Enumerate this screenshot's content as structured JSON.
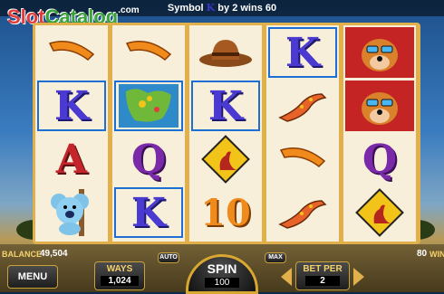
{
  "header": {
    "win_prefix": "Symbol",
    "win_symbol": "K",
    "win_suffix": "by 2 wins 60"
  },
  "logo": {
    "part1": "Slot",
    "part2": "Catalog",
    "tld": ".com"
  },
  "reels": [
    [
      "boomerang",
      "K",
      "A",
      "koala"
    ],
    [
      "boomerang",
      "bonus-map",
      "Q",
      "K"
    ],
    [
      "hat",
      "K",
      "kangaroo-sign",
      "10"
    ],
    [
      "K",
      "lizard",
      "boomerang",
      "lizard"
    ],
    [
      "dingo",
      "dingo",
      "Q",
      "kangaroo-sign"
    ]
  ],
  "balance": {
    "label": "BALANCE",
    "value": "49,504"
  },
  "win": {
    "value": "80",
    "label": "WIN"
  },
  "buttons": {
    "menu": "MENU",
    "auto": "AUTO",
    "max": "MAX",
    "spin": "SPIN",
    "spin_value": "100"
  },
  "ways": {
    "label": "WAYS",
    "value": "1,024"
  },
  "bet": {
    "label": "BET PER",
    "value": "2"
  },
  "colors": {
    "frame": "#e2b04a",
    "win_outline": "#1d6fd6",
    "label": "#f5d36b"
  }
}
